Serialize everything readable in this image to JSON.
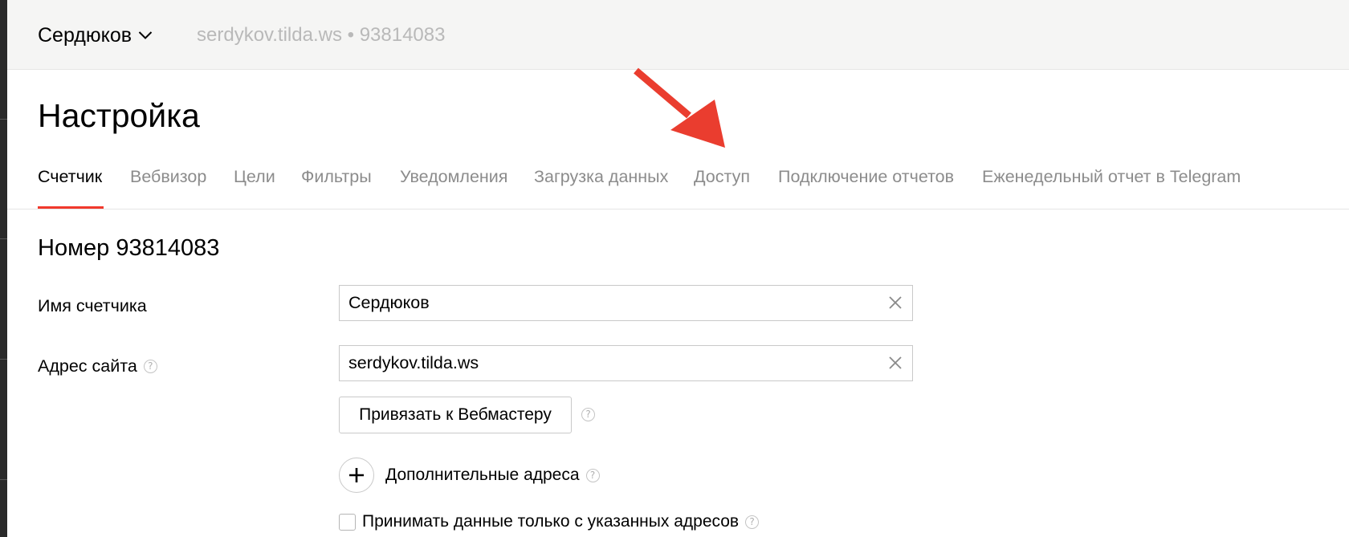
{
  "header": {
    "counter_name": "Сердюков",
    "site_meta": "serdykov.tilda.ws • 93814083"
  },
  "page": {
    "title": "Настройка"
  },
  "tabs": [
    {
      "label": "Счетчик",
      "active": true
    },
    {
      "label": "Вебвизор",
      "active": false
    },
    {
      "label": "Цели",
      "active": false
    },
    {
      "label": "Фильтры",
      "active": false
    },
    {
      "label": "Уведомления",
      "active": false
    },
    {
      "label": "Загрузка данных",
      "active": false
    },
    {
      "label": "Доступ",
      "active": false
    },
    {
      "label": "Подключение отчетов",
      "active": false
    },
    {
      "label": "Еженедельный отчет в Telegram",
      "active": false
    }
  ],
  "section": {
    "title": "Номер 93814083"
  },
  "form": {
    "counter_name_label": "Имя счетчика",
    "counter_name_value": "Сердюков",
    "site_address_label": "Адрес сайта",
    "site_address_value": "serdykov.tilda.ws",
    "webmaster_button_label": "Привязать к Вебмастеру",
    "additional_addresses_label": "Дополнительные адреса",
    "only_specified_label": "Принимать данные только с указанных адресов"
  },
  "icons": {
    "help": "?"
  },
  "colors": {
    "accent": "#f1392c",
    "tab_inactive": "#8c8c8c",
    "header_bg": "#f5f5f4",
    "annotation_arrow": "#ea3d2f"
  }
}
